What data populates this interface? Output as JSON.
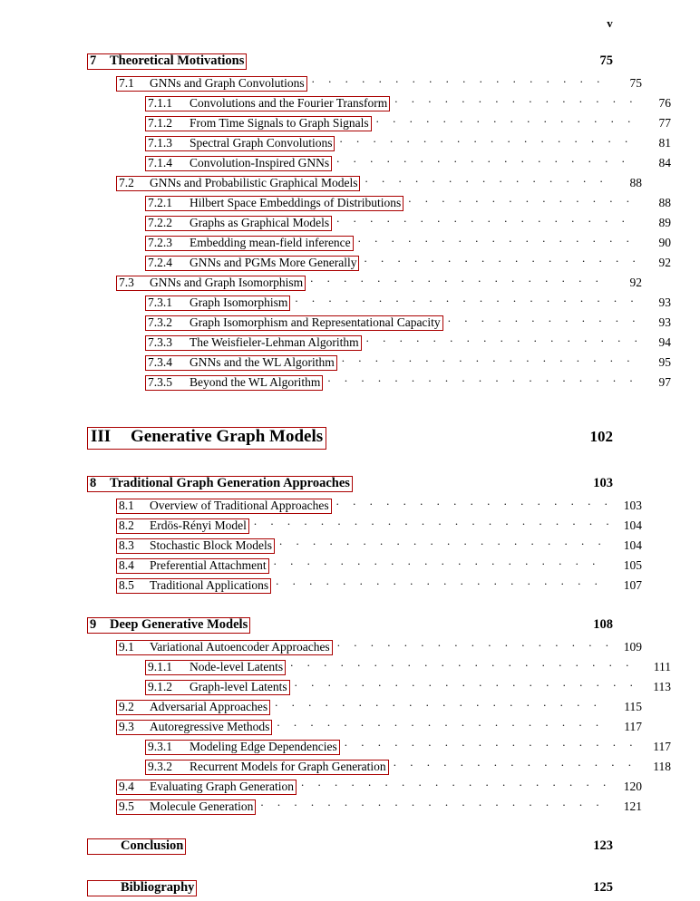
{
  "folio": "v",
  "leader_dots": ". . . . . . . . . . . . . . . . . . . . . . . . . . . . . . . . . . . . . . . . . . . . . . . . .",
  "accent_color": "#AA0000",
  "entries": [
    {
      "level": "chapter",
      "number": "7",
      "title": "Theoretical Motivations",
      "page": "75",
      "leader": false
    },
    {
      "level": "section",
      "number": "7.1",
      "title": "GNNs and Graph Convolutions",
      "page": "75",
      "leader": true
    },
    {
      "level": "subsection",
      "number": "7.1.1",
      "title": "Convolutions and the Fourier Transform",
      "page": "76",
      "leader": true
    },
    {
      "level": "subsection",
      "number": "7.1.2",
      "title": "From Time Signals to Graph Signals",
      "page": "77",
      "leader": true
    },
    {
      "level": "subsection",
      "number": "7.1.3",
      "title": "Spectral Graph Convolutions",
      "page": "81",
      "leader": true
    },
    {
      "level": "subsection",
      "number": "7.1.4",
      "title": "Convolution-Inspired GNNs",
      "page": "84",
      "leader": true
    },
    {
      "level": "section",
      "number": "7.2",
      "title": "GNNs and Probabilistic Graphical Models",
      "page": "88",
      "leader": true
    },
    {
      "level": "subsection",
      "number": "7.2.1",
      "title": "Hilbert Space Embeddings of Distributions",
      "page": "88",
      "leader": true
    },
    {
      "level": "subsection",
      "number": "7.2.2",
      "title": "Graphs as Graphical Models",
      "page": "89",
      "leader": true
    },
    {
      "level": "subsection",
      "number": "7.2.3",
      "title": "Embedding mean-field inference",
      "page": "90",
      "leader": true
    },
    {
      "level": "subsection",
      "number": "7.2.4",
      "title": "GNNs and PGMs More Generally",
      "page": "92",
      "leader": true
    },
    {
      "level": "section",
      "number": "7.3",
      "title": "GNNs and Graph Isomorphism",
      "page": "92",
      "leader": true
    },
    {
      "level": "subsection",
      "number": "7.3.1",
      "title": "Graph Isomorphism",
      "page": "93",
      "leader": true
    },
    {
      "level": "subsection",
      "number": "7.3.2",
      "title": "Graph Isomorphism and Representational Capacity",
      "page": "93",
      "leader": true
    },
    {
      "level": "subsection",
      "number": "7.3.3",
      "title": "The Weisfieler-Lehman Algorithm",
      "page": "94",
      "leader": true
    },
    {
      "level": "subsection",
      "number": "7.3.4",
      "title": "GNNs and the WL Algorithm",
      "page": "95",
      "leader": true
    },
    {
      "level": "subsection",
      "number": "7.3.5",
      "title": "Beyond the WL Algorithm",
      "page": "97",
      "leader": true
    },
    {
      "level": "gap-lg"
    },
    {
      "level": "part",
      "number": "III",
      "title": "Generative Graph Models",
      "page": "102",
      "leader": false
    },
    {
      "level": "gap-md"
    },
    {
      "level": "chapter",
      "number": "8",
      "title": "Traditional Graph Generation Approaches",
      "page": "103",
      "leader": false
    },
    {
      "level": "section",
      "number": "8.1",
      "title": "Overview of Traditional Approaches",
      "page": "103",
      "leader": true
    },
    {
      "level": "section",
      "number": "8.2",
      "title": "Erdös-Rényi Model",
      "page": "104",
      "leader": true
    },
    {
      "level": "section",
      "number": "8.3",
      "title": "Stochastic Block Models",
      "page": "104",
      "leader": true
    },
    {
      "level": "section",
      "number": "8.4",
      "title": "Preferential Attachment",
      "page": "105",
      "leader": true
    },
    {
      "level": "section",
      "number": "8.5",
      "title": "Traditional Applications",
      "page": "107",
      "leader": true
    },
    {
      "level": "gap-md"
    },
    {
      "level": "chapter",
      "number": "9",
      "title": "Deep Generative Models",
      "page": "108",
      "leader": false
    },
    {
      "level": "section",
      "number": "9.1",
      "title": "Variational Autoencoder Approaches",
      "page": "109",
      "leader": true
    },
    {
      "level": "subsection",
      "number": "9.1.1",
      "title": "Node-level Latents",
      "page": "111",
      "leader": true
    },
    {
      "level": "subsection",
      "number": "9.1.2",
      "title": "Graph-level Latents",
      "page": "113",
      "leader": true
    },
    {
      "level": "section",
      "number": "9.2",
      "title": "Adversarial Approaches",
      "page": "115",
      "leader": true
    },
    {
      "level": "section",
      "number": "9.3",
      "title": "Autoregressive Methods",
      "page": "117",
      "leader": true
    },
    {
      "level": "subsection",
      "number": "9.3.1",
      "title": "Modeling Edge Dependencies",
      "page": "117",
      "leader": true
    },
    {
      "level": "subsection",
      "number": "9.3.2",
      "title": "Recurrent Models for Graph Generation",
      "page": "118",
      "leader": true
    },
    {
      "level": "section",
      "number": "9.4",
      "title": "Evaluating Graph Generation",
      "page": "120",
      "leader": true
    },
    {
      "level": "section",
      "number": "9.5",
      "title": "Molecule Generation",
      "page": "121",
      "leader": true
    },
    {
      "level": "gap-md"
    },
    {
      "level": "chapter-unnumbered",
      "number": "",
      "title": "Conclusion",
      "page": "123",
      "leader": false
    },
    {
      "level": "gap-md"
    },
    {
      "level": "chapter-unnumbered",
      "number": "",
      "title": "Bibliography",
      "page": "125",
      "leader": false
    }
  ]
}
